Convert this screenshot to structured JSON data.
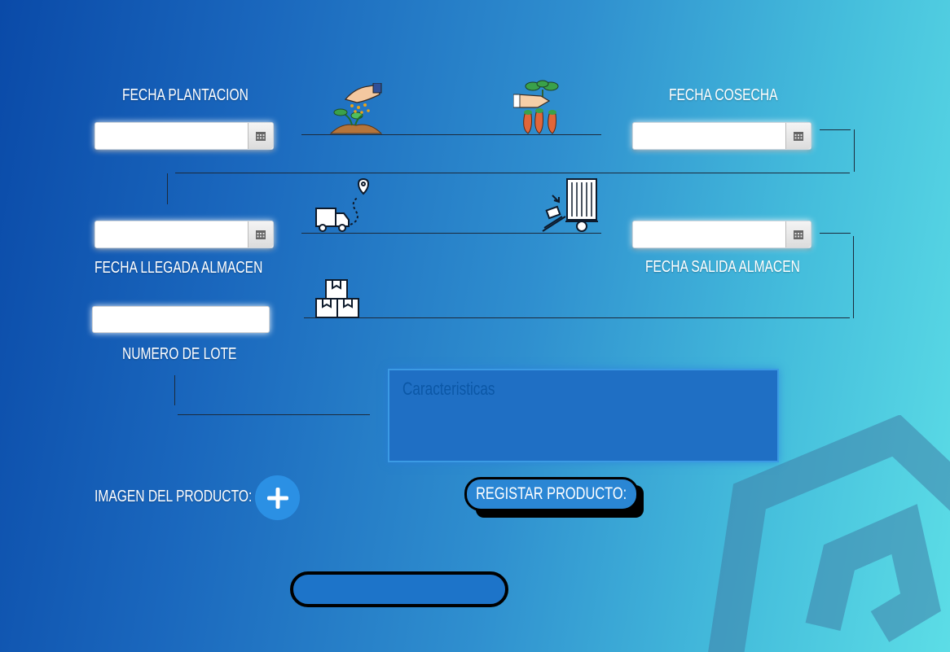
{
  "labels": {
    "fecha_plantacion": "FECHA PLANTACION",
    "fecha_cosecha": "FECHA COSECHA",
    "fecha_llegada_almacen": "FECHA LLEGADA ALMACEN",
    "fecha_salida_almacen": "FECHA SALIDA ALMACEN",
    "numero_de_lote": "NUMERO DE LOTE",
    "imagen_del_producto": "IMAGEN DEL PRODUCTO:"
  },
  "fields": {
    "fecha_plantacion": "",
    "fecha_cosecha": "",
    "fecha_llegada_almacen": "",
    "fecha_salida_almacen": "",
    "numero_de_lote": "",
    "caracteristicas_placeholder": "Caracteristicas"
  },
  "buttons": {
    "registrar": "REGISTAR PRODUCTO:",
    "bottom": ""
  },
  "icons": {
    "planting": "planting-icon",
    "harvest": "harvest-icon",
    "delivery": "delivery-truck-icon",
    "warehouse": "warehouse-trailer-icon",
    "boxes": "stacked-boxes-icon",
    "calendar": "calendar-icon",
    "plus": "plus-icon",
    "logo": "logo-watermark-icon"
  },
  "colors": {
    "accent": "#2b90e4",
    "background_start": "#0a4aa8",
    "background_end": "#5cdde6"
  }
}
